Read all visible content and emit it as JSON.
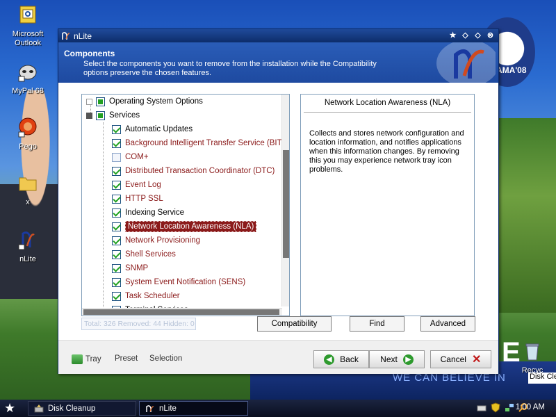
{
  "desktop": {
    "icons": [
      {
        "label": "Microsoft Outlook",
        "name": "outlook"
      },
      {
        "label": "MyPal 68",
        "name": "mypal"
      },
      {
        "label": "Pego",
        "name": "pego"
      },
      {
        "label": "x",
        "name": "folder-x"
      },
      {
        "label": "nLite",
        "name": "nlite"
      }
    ],
    "recycle_label": "Recyc",
    "banner_text": "WE CAN BELIEVE IN",
    "banner_big": "E",
    "logo_text": "AMA'08",
    "popup_text": "Disk Cle"
  },
  "window": {
    "title": "nLite",
    "titlebar_buttons": [
      "★",
      "◇",
      "◇",
      "⊗"
    ],
    "header": {
      "title": "Components",
      "description": "Select the components you want to remove from the installation while the Compatibility options preserve the chosen features."
    },
    "tree": {
      "items": [
        {
          "label": "Operating System Options",
          "state": "mixed",
          "level": 0,
          "color": "black",
          "expander": "closed"
        },
        {
          "label": "Services",
          "state": "mixed",
          "level": 0,
          "color": "black",
          "expander": "open"
        },
        {
          "label": "Automatic Updates",
          "state": "checked",
          "level": 1,
          "color": "black"
        },
        {
          "label": "Background Intelligent Transfer Service (BITS)",
          "state": "checked",
          "level": 1,
          "color": "red"
        },
        {
          "label": "COM+",
          "state": "partial",
          "level": 1,
          "color": "red"
        },
        {
          "label": "Distributed Transaction Coordinator (DTC)",
          "state": "checked",
          "level": 1,
          "color": "red"
        },
        {
          "label": "Event Log",
          "state": "checked",
          "level": 1,
          "color": "red"
        },
        {
          "label": "HTTP SSL",
          "state": "checked",
          "level": 1,
          "color": "red"
        },
        {
          "label": "Indexing Service",
          "state": "checked",
          "level": 1,
          "color": "black"
        },
        {
          "label": "Network Location Awareness (NLA)",
          "state": "checked",
          "level": 1,
          "color": "selected"
        },
        {
          "label": "Network Provisioning",
          "state": "checked",
          "level": 1,
          "color": "red"
        },
        {
          "label": "Shell Services",
          "state": "checked",
          "level": 1,
          "color": "red"
        },
        {
          "label": "SNMP",
          "state": "checked",
          "level": 1,
          "color": "red"
        },
        {
          "label": "System Event Notification (SENS)",
          "state": "checked",
          "level": 1,
          "color": "red"
        },
        {
          "label": "Task Scheduler",
          "state": "checked",
          "level": 1,
          "color": "red"
        },
        {
          "label": "Terminal Services",
          "state": "checked",
          "level": 1,
          "color": "black"
        }
      ]
    },
    "status_text": "Total: 326 Removed: 44 Hidden: 0",
    "info": {
      "title": "Network Location Awareness (NLA)",
      "description": "Collects and stores network configuration and location information, and notifies applications when this information changes. By removing this you may experience network tray icon problems."
    },
    "panel_buttons": {
      "compatibility": "Compatibility",
      "find": "Find",
      "advanced": "Advanced"
    },
    "footer": {
      "tray": "Tray",
      "preset": "Preset",
      "selection": "Selection",
      "back": "Back",
      "next": "Next",
      "cancel": "Cancel"
    }
  },
  "taskbar": {
    "items": [
      {
        "label": "Disk Cleanup",
        "active": false
      },
      {
        "label": "nLite",
        "active": true
      }
    ],
    "clock": "1:00 AM"
  }
}
